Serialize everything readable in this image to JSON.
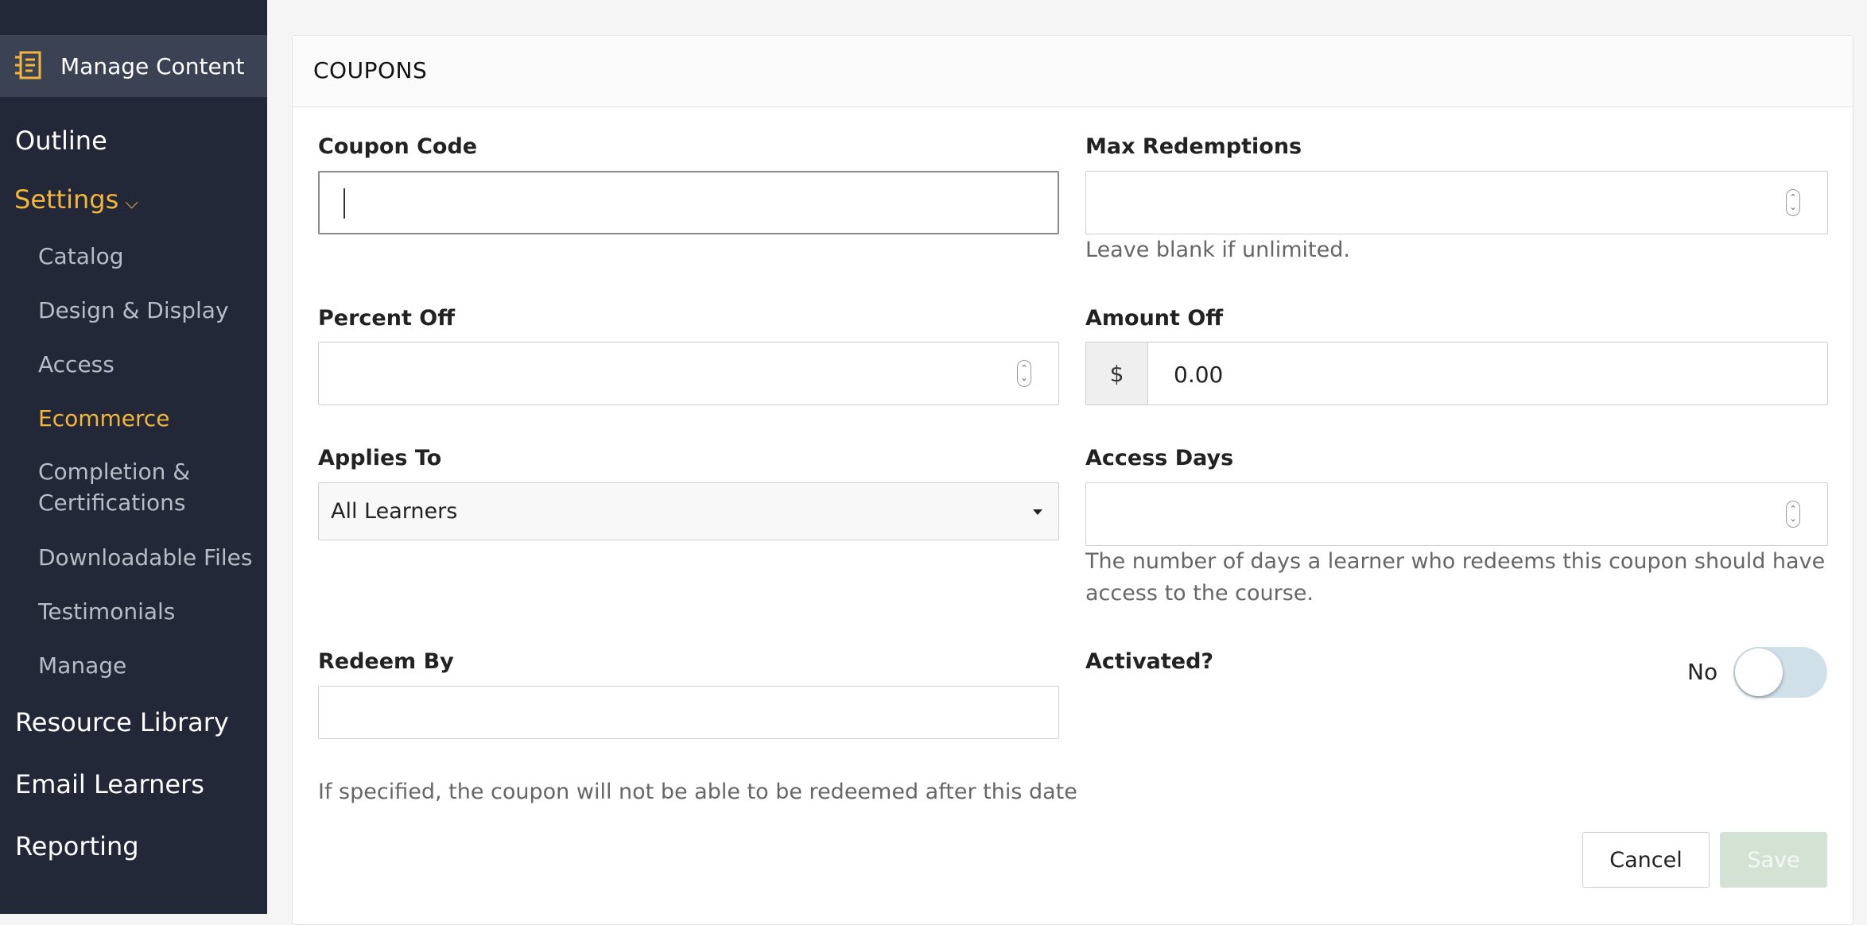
{
  "sidebar": {
    "top_item": {
      "label": "Manage Content",
      "icon": "content-icon"
    },
    "items": [
      {
        "label": "Outline"
      },
      {
        "label": "Settings",
        "active": true,
        "chevron": "⌵"
      },
      {
        "label": "Resource Library"
      },
      {
        "label": "Email Learners"
      },
      {
        "label": "Reporting"
      }
    ],
    "sub_items": [
      {
        "label": "Catalog"
      },
      {
        "label": "Design & Display"
      },
      {
        "label": "Access"
      },
      {
        "label": "Ecommerce",
        "active": true
      },
      {
        "label": "Completion &"
      },
      {
        "label": "Certifications"
      },
      {
        "label": "Downloadable Files"
      },
      {
        "label": "Testimonials"
      },
      {
        "label": "Manage"
      }
    ]
  },
  "card": {
    "title": "COUPONS",
    "coupon_code": {
      "label": "Coupon Code",
      "value": "",
      "placeholder": ""
    },
    "max_redemptions": {
      "label": "Max Redemptions",
      "value": "",
      "help": "Leave blank if unlimited."
    },
    "percent_off": {
      "label": "Percent Off",
      "value": ""
    },
    "amount_off": {
      "label": "Amount Off",
      "prefix": "$",
      "value": "0.00"
    },
    "applies_to": {
      "label": "Applies To",
      "selected": "All Learners"
    },
    "access_days": {
      "label": "Access Days",
      "value": "",
      "help_line1": "The number of days a learner who redeems this coupon should have",
      "help_line2": "access to the course."
    },
    "redeem_by": {
      "label": "Redeem By",
      "value": "",
      "help": "If specified, the coupon will not be able to be redeemed after this date"
    },
    "activated": {
      "label": "Activated?",
      "state_label": "No",
      "on": false
    },
    "buttons": {
      "cancel": "Cancel",
      "save": "Save"
    }
  },
  "colors": {
    "sidebar_bg": "#222838",
    "active": "#f3b53c",
    "toggle_off": "#cfe0e9",
    "save_disabled": "#d4e2d4"
  }
}
